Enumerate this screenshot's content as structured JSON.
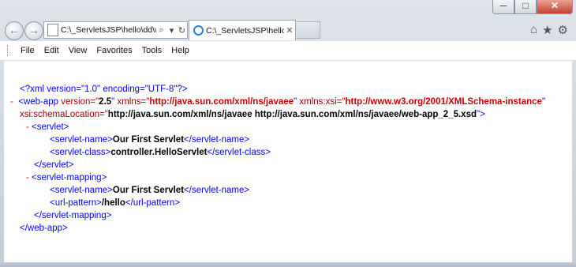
{
  "window": {
    "minimize_glyph": "─",
    "maximize_glyph": "□",
    "close_glyph": "✕"
  },
  "nav": {
    "back_glyph": "←",
    "forward_glyph": "→"
  },
  "address_bar": {
    "value": "C:\\_ServletsJSP\\hello\\dd\\web.xml",
    "search_glyph": "⌕",
    "dropdown_glyph": "▾",
    "refresh_glyph": "↻"
  },
  "tab": {
    "title": "C:\\_ServletsJSP\\hello\\dd\\w...",
    "close_glyph": "✕"
  },
  "toolbar_icons": {
    "home_glyph": "⌂",
    "favorites_glyph": "★",
    "tools_glyph": "⚙"
  },
  "menu": {
    "items": [
      "File",
      "Edit",
      "View",
      "Favorites",
      "Tools",
      "Help"
    ]
  },
  "xml": {
    "decl": "<?xml version=\"1.0\" encoding=\"UTF-8\"?>",
    "collapse_dash": "-",
    "webapp_open_tag": "<web-app",
    "version_attr": "version=\"",
    "version_val": "2.5",
    "quote_close": "\"",
    "xmlns_attr": "xmlns=\"",
    "xmlns_val": "http://java.sun.com/xml/ns/javaee",
    "xsi_attr": "xmlns:xsi=\"",
    "xsi_val": "http://www.w3.org/2001/XMLSchema-instance",
    "schema_attr": "xsi:schemaLocation=\"",
    "schema_val": "http://java.sun.com/xml/ns/javaee http://java.sun.com/xml/ns/javaee/web-app_2_5.xsd",
    "tag_end": "\">",
    "servlet_open": "<servlet>",
    "servlet_name_open": "<servlet-name>",
    "servlet_name_val": "Our First Servlet",
    "servlet_name_close": "</servlet-name>",
    "servlet_class_open": "<servlet-class>",
    "servlet_class_val": "controller.HelloServlet",
    "servlet_class_close": "</servlet-class>",
    "servlet_close": "</servlet>",
    "mapping_open": "<servlet-mapping>",
    "mapping_name_val": "Our First Servlet",
    "url_open": "<url-pattern>",
    "url_val": "/hello",
    "url_close": "</url-pattern>",
    "mapping_close": "</servlet-mapping>",
    "webapp_close": "</web-app>"
  }
}
